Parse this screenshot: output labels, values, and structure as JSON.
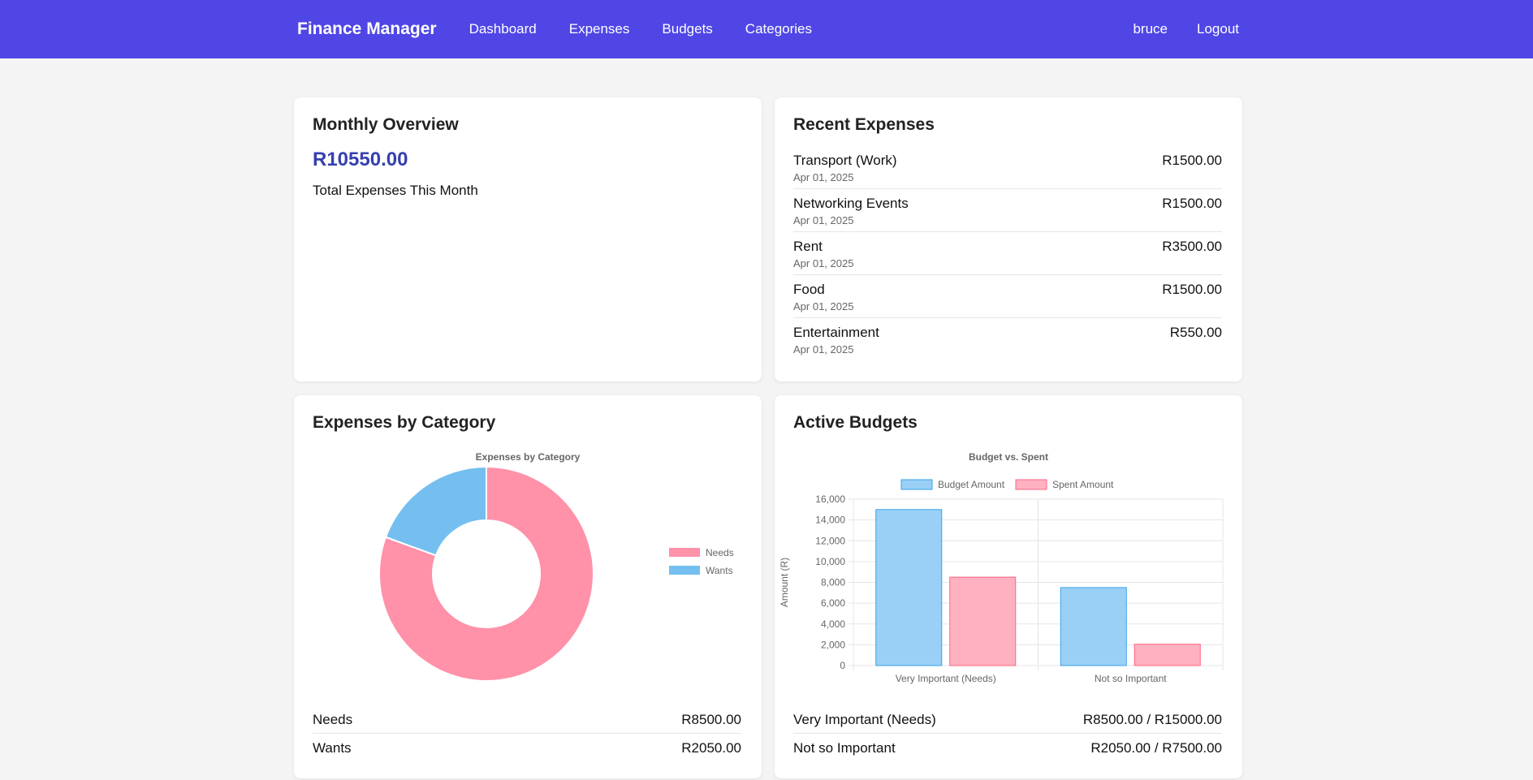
{
  "nav": {
    "brand": "Finance Manager",
    "links": [
      "Dashboard",
      "Expenses",
      "Budgets",
      "Categories"
    ],
    "user": "bruce",
    "logout": "Logout"
  },
  "overview": {
    "title": "Monthly Overview",
    "amount": "R10550.00",
    "caption": "Total Expenses This Month"
  },
  "recent": {
    "title": "Recent Expenses",
    "items": [
      {
        "name": "Transport (Work)",
        "date": "Apr 01, 2025",
        "amount": "R1500.00"
      },
      {
        "name": "Networking Events",
        "date": "Apr 01, 2025",
        "amount": "R1500.00"
      },
      {
        "name": "Rent",
        "date": "Apr 01, 2025",
        "amount": "R3500.00"
      },
      {
        "name": "Food",
        "date": "Apr 01, 2025",
        "amount": "R1500.00"
      },
      {
        "name": "Entertainment",
        "date": "Apr 01, 2025",
        "amount": "R550.00"
      }
    ]
  },
  "category_card": {
    "title": "Expenses by Category",
    "rows": [
      {
        "label": "Needs",
        "value": "R8500.00"
      },
      {
        "label": "Wants",
        "value": "R2050.00"
      }
    ]
  },
  "budgets_card": {
    "title": "Active Budgets",
    "rows": [
      {
        "label": "Very Important (Needs)",
        "value": "R8500.00 / R15000.00"
      },
      {
        "label": "Not so Important",
        "value": "R2050.00 / R7500.00"
      }
    ]
  },
  "colors": {
    "nav": "#4f46e5",
    "needs": "#ff91a9",
    "wants": "#74bff0",
    "budget_fill": "#9ad0f5",
    "budget_stroke": "#36a2eb",
    "spent_fill": "#ffb1c1",
    "spent_stroke": "#ff6384"
  },
  "chart_data": [
    {
      "type": "pie",
      "title": "Expenses by Category",
      "categories": [
        "Needs",
        "Wants"
      ],
      "values": [
        8500,
        2050
      ],
      "legend": "right"
    },
    {
      "type": "bar",
      "title": "Budget vs. Spent",
      "categories": [
        "Very Important (Needs)",
        "Not so Important"
      ],
      "series": [
        {
          "name": "Budget Amount",
          "values": [
            15000,
            7500
          ]
        },
        {
          "name": "Spent Amount",
          "values": [
            8500,
            2050
          ]
        }
      ],
      "ylabel": "Amount (R)",
      "ylim": [
        0,
        16000
      ],
      "yticks": [
        "16,000",
        "14,000",
        "12,000",
        "10,000",
        "8,000",
        "6,000",
        "4,000",
        "2,000",
        "0"
      ],
      "grid": true,
      "legend": "top"
    }
  ]
}
